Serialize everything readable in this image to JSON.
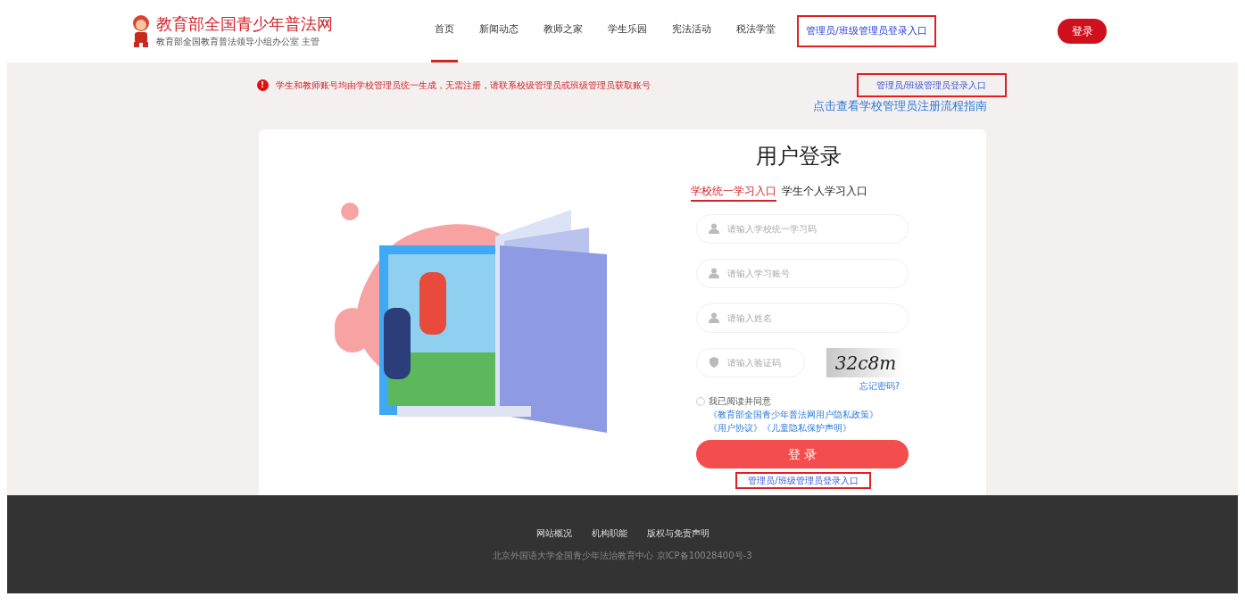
{
  "header": {
    "site_title": "教育部全国青少年普法网",
    "site_subtitle": "教育部全国教育普法领导小组办公室 主管",
    "nav": [
      {
        "label": "首页",
        "selected": true,
        "highlighted": false
      },
      {
        "label": "新闻动态",
        "selected": false,
        "highlighted": false
      },
      {
        "label": "教师之家",
        "selected": false,
        "highlighted": false
      },
      {
        "label": "学生乐园",
        "selected": false,
        "highlighted": false
      },
      {
        "label": "宪法活动",
        "selected": false,
        "highlighted": false
      },
      {
        "label": "税法学堂",
        "selected": false,
        "highlighted": false
      },
      {
        "label": "管理员/班级管理员登录入口",
        "selected": false,
        "highlighted": true
      }
    ],
    "login_button": "登录"
  },
  "notice": {
    "icon": "!",
    "text": "学生和教师账号均由学校管理员统一生成，无需注册，请联系校级管理员或班级管理员获取账号",
    "admin_link": {
      "label": "管理员/班级管理员登录入口",
      "highlighted": true
    },
    "guide_link": "点击查看学校管理员注册流程指南"
  },
  "login": {
    "title": "用户登录",
    "tabs": [
      {
        "label": "学校统一学习入口",
        "selected": true
      },
      {
        "label": "学生个人学习入口",
        "selected": false
      }
    ],
    "fields": [
      {
        "kind": "user",
        "placeholder": "请输入学校统一学习码"
      },
      {
        "kind": "user",
        "placeholder": "请输入学习账号"
      },
      {
        "kind": "user",
        "placeholder": "请输入姓名"
      },
      {
        "kind": "captcha",
        "placeholder": "请输入验证码",
        "captcha": "32c8m"
      }
    ],
    "forgot": "忘记密码?",
    "agreement": {
      "checked": false,
      "text": "我已阅读并同意",
      "links": [
        "《教育部全国青少年普法网用户隐私政策》",
        "《用户协议》",
        "《儿童隐私保护声明》"
      ]
    },
    "submit": "登 录",
    "admin_link": {
      "label": "管理员/班级管理员登录入口",
      "highlighted": true
    }
  },
  "footer": {
    "links": [
      "网站概况",
      "机构职能",
      "版权与免责声明"
    ],
    "copyright": "北京外国语大学全国青少年法治教育中心 京ICP备10028400号-3"
  }
}
